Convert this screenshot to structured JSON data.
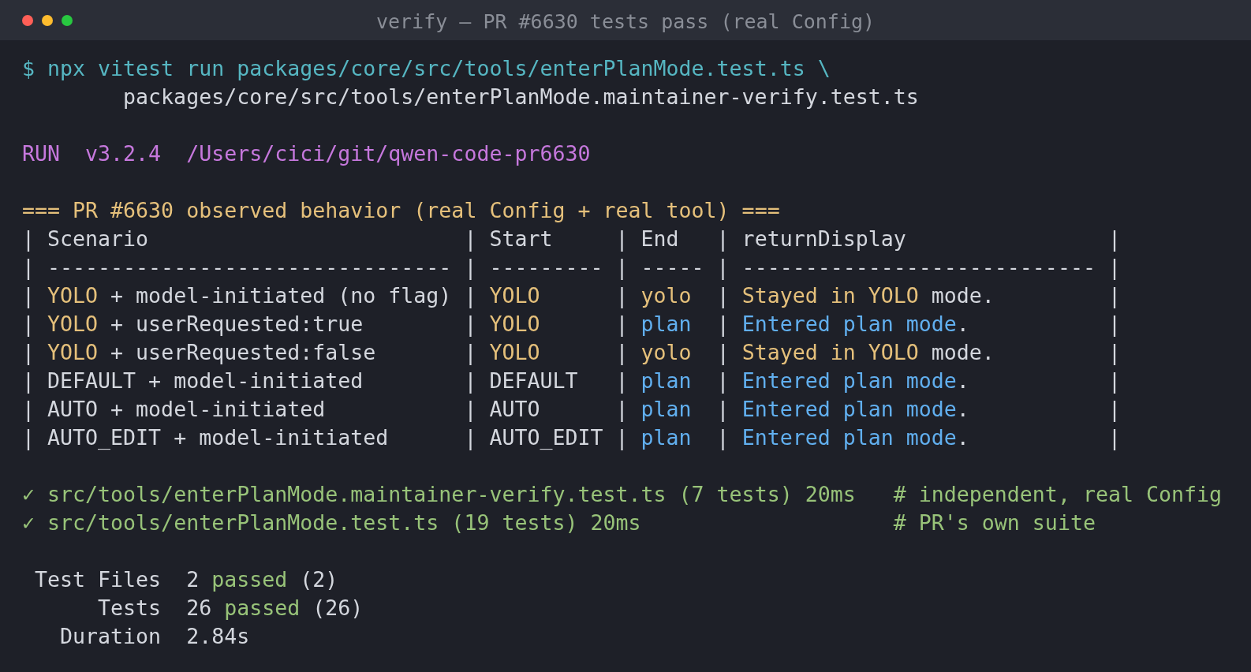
{
  "window": {
    "title": "verify — PR #6630 tests pass (real Config)"
  },
  "blocks": [
    {
      "lines": [
        {
          "kind": "command",
          "segments": [
            {
              "kind": "command",
              "text": "$ npx vitest run packages/core/src/tools/enterPlanMode.test.ts \\"
            }
          ]
        },
        {
          "kind": "continuation",
          "segments": [
            {
              "kind": "plain",
              "text": "packages/core/src/tools/enterPlanMode.maintainer-verify.test.ts"
            }
          ]
        }
      ]
    },
    {
      "lines": [
        {
          "kind": "output",
          "segments": [
            {
              "kind": "meta",
              "text": "RUN  v3.2.4  /Users/cici/git/qwen-code-pr6630"
            }
          ]
        }
      ]
    },
    {
      "lines": [
        {
          "kind": "output",
          "segments": [
            {
              "kind": "heading",
              "text": "=== PR #6630 observed behavior (real Config + real tool) ==="
            }
          ]
        },
        {
          "kind": "output",
          "segments": [
            {
              "kind": "plain",
              "text": "| Scenario                         | Start     | End   | returnDisplay                |"
            }
          ]
        },
        {
          "kind": "output",
          "segments": [
            {
              "kind": "plain",
              "text": "| -------------------------------- | --------- | ----- | ---------------------------- |"
            }
          ]
        },
        {
          "kind": "output",
          "segments": [
            {
              "kind": "plain",
              "text": "| "
            },
            {
              "kind": "yolo",
              "text": "YOLO"
            },
            {
              "kind": "plain",
              "text": " + model-initiated (no flag) | "
            },
            {
              "kind": "yolo",
              "text": "YOLO"
            },
            {
              "kind": "plain",
              "text": "      | "
            },
            {
              "kind": "yolo",
              "text": "yolo"
            },
            {
              "kind": "plain",
              "text": "  | "
            },
            {
              "kind": "yolo",
              "text": "Stayed in YOLO"
            },
            {
              "kind": "plain",
              "text": " mode.         |"
            }
          ]
        },
        {
          "kind": "output",
          "segments": [
            {
              "kind": "plain",
              "text": "| "
            },
            {
              "kind": "yolo",
              "text": "YOLO"
            },
            {
              "kind": "plain",
              "text": " + userRequested:true        | "
            },
            {
              "kind": "yolo",
              "text": "YOLO"
            },
            {
              "kind": "plain",
              "text": "      | "
            },
            {
              "kind": "plan",
              "text": "plan"
            },
            {
              "kind": "plain",
              "text": "  | "
            },
            {
              "kind": "plan",
              "text": "Entered plan mode"
            },
            {
              "kind": "plain",
              "text": ".           |"
            }
          ]
        },
        {
          "kind": "output",
          "segments": [
            {
              "kind": "plain",
              "text": "| "
            },
            {
              "kind": "yolo",
              "text": "YOLO"
            },
            {
              "kind": "plain",
              "text": " + userRequested:false       | "
            },
            {
              "kind": "yolo",
              "text": "YOLO"
            },
            {
              "kind": "plain",
              "text": "      | "
            },
            {
              "kind": "yolo",
              "text": "yolo"
            },
            {
              "kind": "plain",
              "text": "  | "
            },
            {
              "kind": "yolo",
              "text": "Stayed in YOLO"
            },
            {
              "kind": "plain",
              "text": " mode.         |"
            }
          ]
        },
        {
          "kind": "output",
          "segments": [
            {
              "kind": "plain",
              "text": "| DEFAULT + model-initiated        | DEFAULT   | "
            },
            {
              "kind": "plan",
              "text": "plan"
            },
            {
              "kind": "plain",
              "text": "  | "
            },
            {
              "kind": "plan",
              "text": "Entered plan mode"
            },
            {
              "kind": "plain",
              "text": ".           |"
            }
          ]
        },
        {
          "kind": "output",
          "segments": [
            {
              "kind": "plain",
              "text": "| AUTO + model-initiated           | AUTO      | "
            },
            {
              "kind": "plan",
              "text": "plan"
            },
            {
              "kind": "plain",
              "text": "  | "
            },
            {
              "kind": "plan",
              "text": "Entered plan mode"
            },
            {
              "kind": "plain",
              "text": ".           |"
            }
          ]
        },
        {
          "kind": "output",
          "segments": [
            {
              "kind": "plain",
              "text": "| AUTO_EDIT + model-initiated      | AUTO_EDIT | "
            },
            {
              "kind": "plan",
              "text": "plan"
            },
            {
              "kind": "plain",
              "text": "  | "
            },
            {
              "kind": "plan",
              "text": "Entered plan mode"
            },
            {
              "kind": "plain",
              "text": ".           |"
            }
          ]
        }
      ]
    },
    {
      "lines": [
        {
          "kind": "output",
          "segments": [
            {
              "kind": "pass",
              "text": "✓ src/tools/enterPlanMode.maintainer-verify.test.ts (7 tests) 20ms   # independent, real Config"
            }
          ]
        },
        {
          "kind": "output",
          "segments": [
            {
              "kind": "pass",
              "text": "✓ src/tools/enterPlanMode.test.ts (19 tests) 20ms                    # PR's own suite"
            }
          ]
        }
      ]
    }
  ],
  "summary": [
    {
      "label": "Test Files",
      "segments": [
        {
          "kind": "plain",
          "text": "2 "
        },
        {
          "kind": "pass",
          "text": "passed"
        },
        {
          "kind": "plain",
          "text": " (2)"
        }
      ]
    },
    {
      "label": "Tests",
      "segments": [
        {
          "kind": "plain",
          "text": "26 "
        },
        {
          "kind": "pass",
          "text": "passed"
        },
        {
          "kind": "plain",
          "text": " (26)"
        }
      ]
    },
    {
      "label": "Duration",
      "segments": [
        {
          "kind": "plain",
          "text": "2.84s"
        }
      ]
    }
  ]
}
